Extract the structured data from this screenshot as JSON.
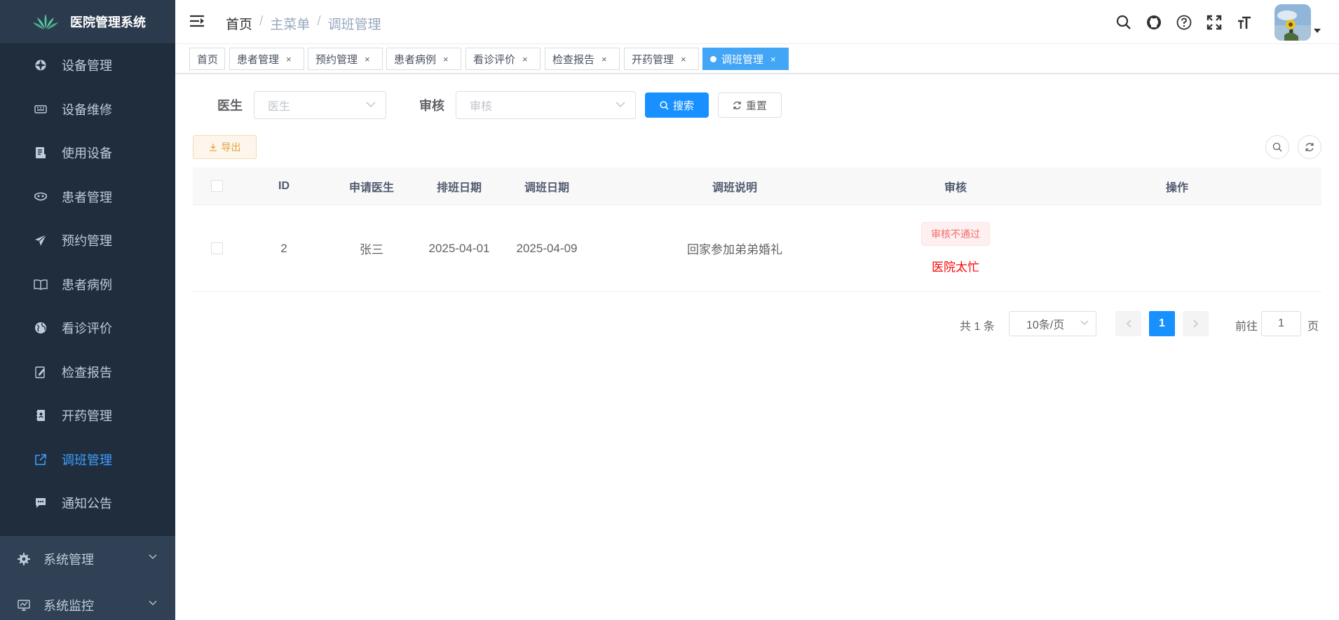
{
  "app": {
    "title": "医院管理系统",
    "brand_color": "#304156",
    "accent": "#409eff"
  },
  "sidebar": {
    "items": [
      {
        "label": "设备管理",
        "icon": "gear-wheel-icon"
      },
      {
        "label": "设备维修",
        "icon": "keyboard-icon"
      },
      {
        "label": "使用设备",
        "icon": "document-icon"
      },
      {
        "label": "患者管理",
        "icon": "mask-icon"
      },
      {
        "label": "预约管理",
        "icon": "paper-plane-icon"
      },
      {
        "label": "患者病例",
        "icon": "book-icon"
      },
      {
        "label": "看诊评价",
        "icon": "globe-icon"
      },
      {
        "label": "检查报告",
        "icon": "edit-icon"
      },
      {
        "label": "开药管理",
        "icon": "contacts-book-icon"
      },
      {
        "label": "调班管理",
        "icon": "external-link-icon",
        "active": true
      },
      {
        "label": "通知公告",
        "icon": "message-icon"
      }
    ],
    "submenus": [
      {
        "label": "系统管理",
        "icon": "settings-icon"
      },
      {
        "label": "系统监控",
        "icon": "monitor-icon"
      }
    ]
  },
  "header": {
    "breadcrumb": [
      "首页",
      "主菜单",
      "调班管理"
    ]
  },
  "tags": [
    {
      "label": "首页",
      "closable": false
    },
    {
      "label": "患者管理",
      "closable": true
    },
    {
      "label": "预约管理",
      "closable": true
    },
    {
      "label": "患者病例",
      "closable": true
    },
    {
      "label": "看诊评价",
      "closable": true
    },
    {
      "label": "检查报告",
      "closable": true
    },
    {
      "label": "开药管理",
      "closable": true
    },
    {
      "label": "调班管理",
      "closable": true,
      "active": true
    }
  ],
  "search": {
    "doctor_label": "医生",
    "doctor_placeholder": "医生",
    "audit_label": "审核",
    "audit_placeholder": "审核",
    "search_button": "搜索",
    "reset_button": "重置"
  },
  "toolbar": {
    "export_label": "导出"
  },
  "table": {
    "columns": [
      "ID",
      "申请医生",
      "排班日期",
      "调班日期",
      "调班说明",
      "审核",
      "操作"
    ],
    "rows": [
      {
        "id": "2",
        "doctor": "张三",
        "schedule_date": "2025-04-01",
        "shift_date": "2025-04-09",
        "description": "回家参加弟弟婚礼",
        "audit_status": "审核不通过",
        "audit_reason": "医院太忙",
        "operation": ""
      }
    ]
  },
  "pagination": {
    "total_text": "共 1 条",
    "page_size": "10条/页",
    "current_page": "1",
    "goto_label": "前往",
    "goto_value": "1",
    "page_suffix": "页"
  }
}
